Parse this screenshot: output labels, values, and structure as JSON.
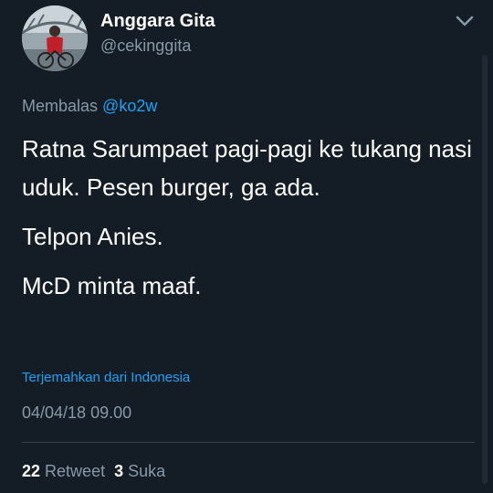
{
  "user": {
    "display_name": "Anggara Gita",
    "handle": "@cekinggita",
    "avatar_icon": "profile-photo-cyclist"
  },
  "reply": {
    "prefix": "Membalas",
    "mention": "@ko2w"
  },
  "tweet": {
    "paragraphs": [
      "Ratna Sarumpaet pagi-pagi ke tukang nasi uduk. Pesen burger, ga ada.",
      "Telpon Anies.",
      "McD minta maaf."
    ],
    "translate_label": "Terjemahkan dari Indonesia",
    "timestamp": "04/04/18 09.00"
  },
  "stats": {
    "retweet_count": "22",
    "retweet_label": "Retweet",
    "like_count": "3",
    "like_label": "Suka"
  },
  "icons": {
    "menu": "chevron-down-icon"
  },
  "colors": {
    "background": "#141d26",
    "secondary_text": "#8899a6",
    "link": "#1da1f2",
    "divider": "#38444d"
  }
}
